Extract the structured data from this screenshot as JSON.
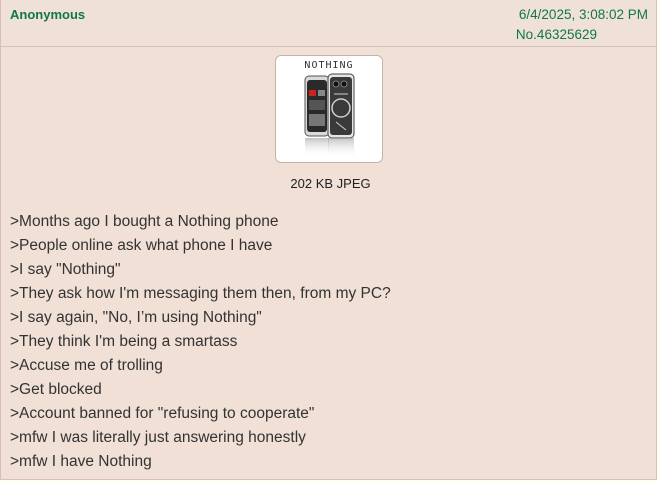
{
  "post": {
    "name": "Anonymous",
    "datetime": "6/4/2025, 3:08:02 PM",
    "number": "No.46325629"
  },
  "image": {
    "title": "NOTHING",
    "file_info": "202 KB JPEG"
  },
  "lines": [
    ">Months ago I bought a Nothing phone",
    ">People online ask what phone I have",
    ">I say \"Nothing\"",
    ">They ask how I'm messaging them then, from my PC?",
    ">I say again, \"No, I’m using Nothing\"",
    ">They think I'm being a smartass",
    ">Accuse me of trolling",
    ">Get blocked",
    ">Account banned for \"refusing to cooperate\"",
    ">mfw I was literally just answering honestly",
    ">mfw I have Nothing"
  ]
}
